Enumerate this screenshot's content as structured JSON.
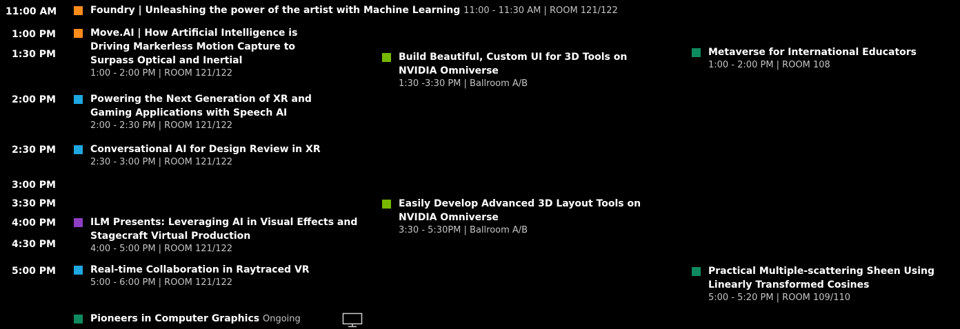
{
  "colors": {
    "orange": "#ff8c1a",
    "blue": "#1ea7e1",
    "lime": "#76b900",
    "teal": "#0f8a5f",
    "purple": "#8e3ec4"
  },
  "times": [
    "11:00 AM",
    "1:00 PM",
    "1:30 PM",
    "2:00 PM",
    "2:30 PM",
    "3:00 PM",
    "3:30 PM",
    "4:00 PM",
    "4:30 PM",
    "5:00 PM"
  ],
  "events": {
    "foundry": {
      "title": "Foundry | Unleashing the power of the artist with Machine Learning",
      "sub": "11:00 - 11:30 AM | ROOM 121/122"
    },
    "moveai": {
      "title": "Move.AI | How Artificial Intelligence is Driving Markerless Motion Capture to Surpass Optical and Inertial",
      "sub": "1:00 - 2:00 PM | ROOM 121/122"
    },
    "speechai": {
      "title": "Powering the Next Generation of XR and Gaming Applications with Speech AI",
      "sub": "2:00 - 2:30 PM | ROOM 121/122"
    },
    "convai": {
      "title": "Conversational AI for Design Review in XR",
      "sub": "2:30 - 3:00 PM | ROOM 121/122"
    },
    "ilm": {
      "title": "ILM Presents: Leveraging AI in Visual Effects and Stagecraft Virtual Production",
      "sub": "4:00 - 5:00 PM | ROOM 121/122"
    },
    "raytrace": {
      "title": "Real-time Collaboration in Raytraced VR",
      "sub": "5:00 - 6:00 PM | ROOM 121/122"
    },
    "pioneers": {
      "title": "Pioneers in Computer Graphics",
      "sub": "Ongoing"
    },
    "customui": {
      "title": "Build Beautiful, Custom UI for 3D Tools on NVIDIA Omniverse",
      "sub": "1:30 -3:30 PM | Ballroom A/B"
    },
    "layout3d": {
      "title": "Easily Develop Advanced 3D Layout Tools on NVIDIA Omniverse",
      "sub": "3:30 - 5:30PM | Ballroom A/B"
    },
    "metaverse": {
      "title": "Metaverse for International Educators",
      "sub": "1:00 - 2:00 PM | ROOM 108"
    },
    "sheen": {
      "title": "Practical Multiple-scattering Sheen Using Linearly Transformed Cosines",
      "sub": "5:00 - 5:20 PM | ROOM 109/110"
    }
  },
  "icons": {
    "pioneers_icon": "monitor-icon"
  }
}
